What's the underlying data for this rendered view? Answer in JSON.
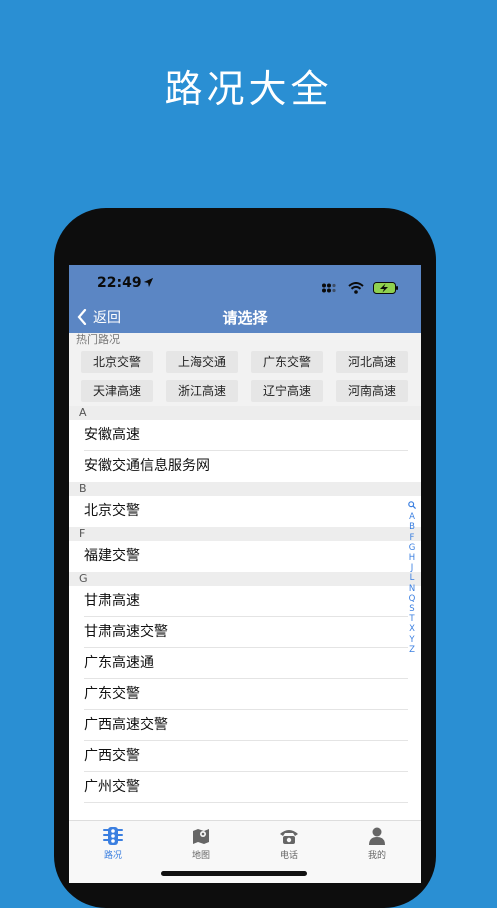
{
  "promo": {
    "title": "路况大全"
  },
  "status": {
    "time": "22:49"
  },
  "nav": {
    "back_label": "返回",
    "title": "请选择"
  },
  "hot": {
    "header": "热门路况",
    "rows": [
      [
        "北京交警",
        "上海交通",
        "广东交警",
        "河北高速"
      ],
      [
        "天津高速",
        "浙江高速",
        "辽宁高速",
        "河南高速"
      ]
    ]
  },
  "sections": [
    {
      "letter": "A",
      "items": [
        "安徽高速",
        "安徽交通信息服务网"
      ]
    },
    {
      "letter": "B",
      "items": [
        "北京交警"
      ]
    },
    {
      "letter": "F",
      "items": [
        "福建交警"
      ]
    },
    {
      "letter": "G",
      "items": [
        "甘肃高速",
        "甘肃高速交警",
        "广东高速通",
        "广东交警",
        "广西高速交警",
        "广西交警",
        "广州交警"
      ]
    }
  ],
  "index": [
    "🔍",
    "A",
    "B",
    "F",
    "G",
    "H",
    "J",
    "L",
    "N",
    "Q",
    "S",
    "T",
    "X",
    "Y",
    "Z"
  ],
  "tabs": [
    {
      "label": "路况",
      "icon": "traffic-light-icon",
      "active": true
    },
    {
      "label": "地图",
      "icon": "map-icon",
      "active": false
    },
    {
      "label": "电话",
      "icon": "phone-icon",
      "active": false
    },
    {
      "label": "我的",
      "icon": "profile-icon",
      "active": false
    }
  ],
  "colors": {
    "background": "#2a8fd3",
    "navbar": "#5b86c4",
    "accent": "#3b7fe0"
  }
}
